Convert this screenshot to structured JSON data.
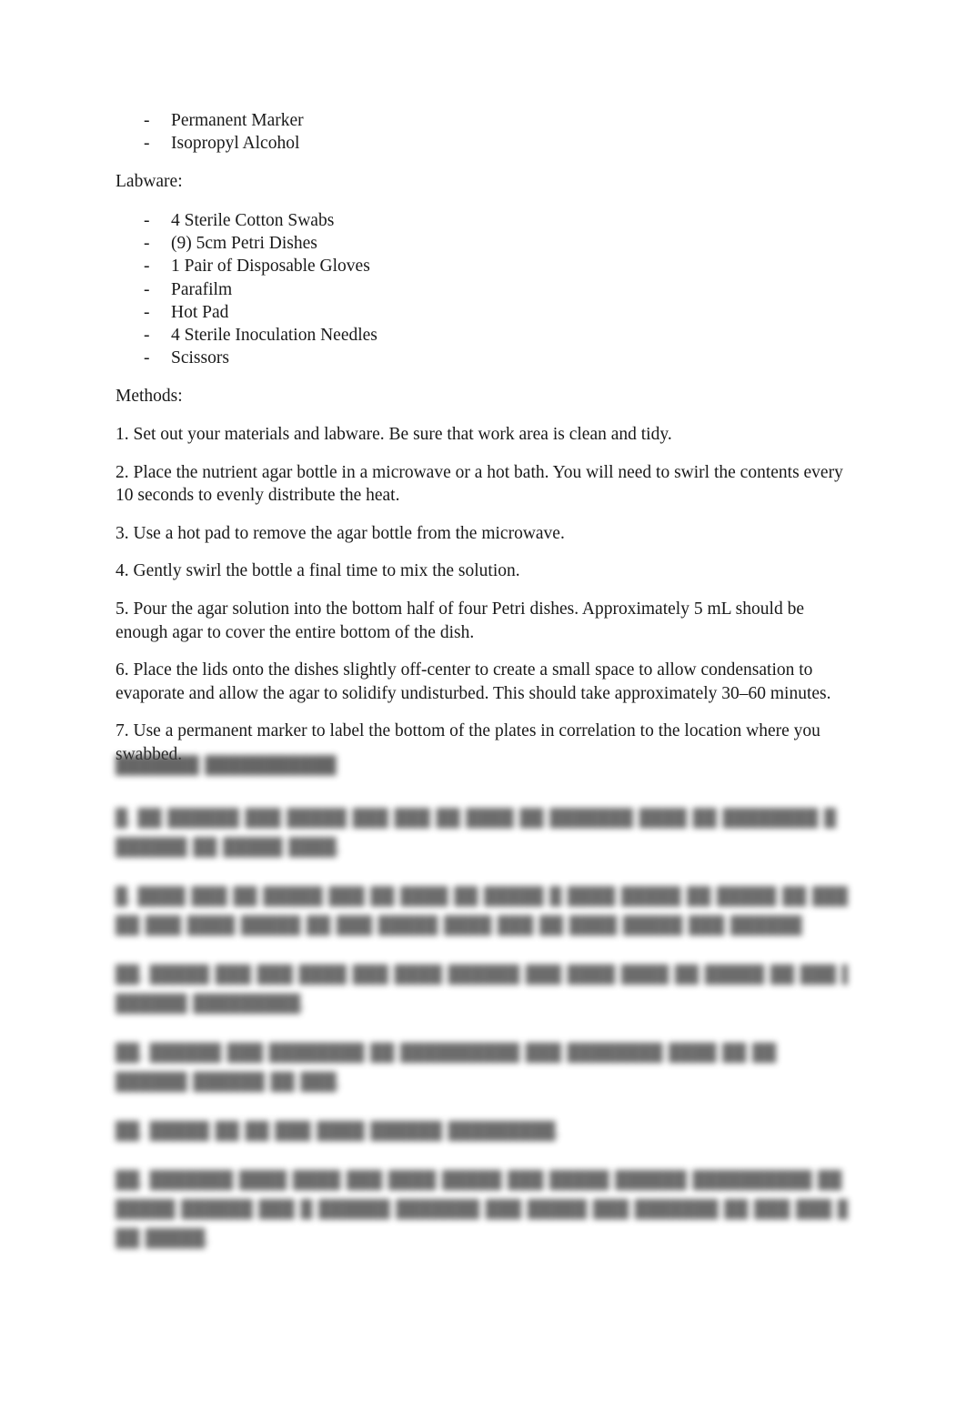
{
  "document": {
    "type": "lab-protocol",
    "page_background": "#ffffff",
    "text_color": "#1a1a1a",
    "materials_list_top": [
      {
        "marker": "-",
        "text": "Permanent Marker"
      },
      {
        "marker": "-",
        "text": "Isopropyl Alcohol"
      }
    ],
    "labware": {
      "heading": "Labware:",
      "items": [
        {
          "marker": "-",
          "text": "4 Sterile Cotton Swabs"
        },
        {
          "marker": "-",
          "text": "(9) 5cm Petri Dishes"
        },
        {
          "marker": "-",
          "text": "1 Pair of Disposable Gloves"
        },
        {
          "marker": "-",
          "text": "Parafilm"
        },
        {
          "marker": "-",
          "text": "Hot Pad"
        },
        {
          "marker": "-",
          "text": "4 Sterile Inoculation Needles"
        },
        {
          "marker": "-",
          "text": "Scissors"
        }
      ]
    },
    "methods": {
      "heading": "Methods:",
      "steps": [
        "1. Set out your materials and labware. Be sure that work area is clean and tidy.",
        "2. Place the nutrient agar bottle in a microwave or a hot bath. You will need to swirl the contents every 10 seconds to evenly distribute the heat.",
        "3. Use a hot pad to remove the agar bottle from the microwave.",
        "4. Gently swirl the bottle a final time to mix the solution.",
        "5. Pour the agar solution into the bottom half of four Petri dishes. Approximately 5 mL should be enough agar to cover the entire bottom of the dish.",
        "6. Place the lids onto the dishes slightly off-center to create a small space to allow condensation to evaporate and allow the agar to solidify undisturbed. This should take approximately 30–60 minutes.",
        "7. Use a permanent marker to label the bottom of the plates in correlation to the location where you swabbed."
      ]
    },
    "redacted_section": {
      "note": "blurred-illegible",
      "blocks": [
        {
          "kind": "heading",
          "lines": [
            "███████ ███████████"
          ]
        },
        {
          "kind": "paragraph",
          "lines": [
            "█. ██ ██████ ███ █████ ███ ███ ██ ████ ██ ███████ ████ ██ ████████ █",
            "██████ ██ █████ ████."
          ]
        },
        {
          "kind": "paragraph",
          "lines": [
            "█. ████ ███ ██ █████ ███ ██ ████ ██ █████ █ ████ █████ ██ █████ ██ ███",
            "██ ███ ████ █████ ██ ███ █████ ████ ███ ██ ████ █████ ███ ██████"
          ]
        },
        {
          "kind": "paragraph",
          "lines": [
            "██. █████ ███ ███ ████ ███ ████ ██████ ███ ████ ████ ██ █████ ██ ███ █ ██████",
            "██████ █████████."
          ]
        },
        {
          "kind": "paragraph",
          "lines": [
            "██. ██████ ███ ████████ ██ ██████████ ███ ████████ ████ ██ ██",
            "██████ ██████ ██ ███."
          ]
        },
        {
          "kind": "paragraph",
          "lines": [
            "██. █████ ██ ██ ███ ████ ██████ █████████."
          ]
        },
        {
          "kind": "paragraph",
          "lines": [
            "██. ███████ ████ ████ ███ ████ █████ ███ █████ ██████ ██████████ ██ ███",
            "█████ ██████ ███ █ ██████ ███████ ███ █████ ███ ███████ ██ ███ ███ █████ ██ ███",
            "██ █████."
          ]
        }
      ]
    }
  }
}
